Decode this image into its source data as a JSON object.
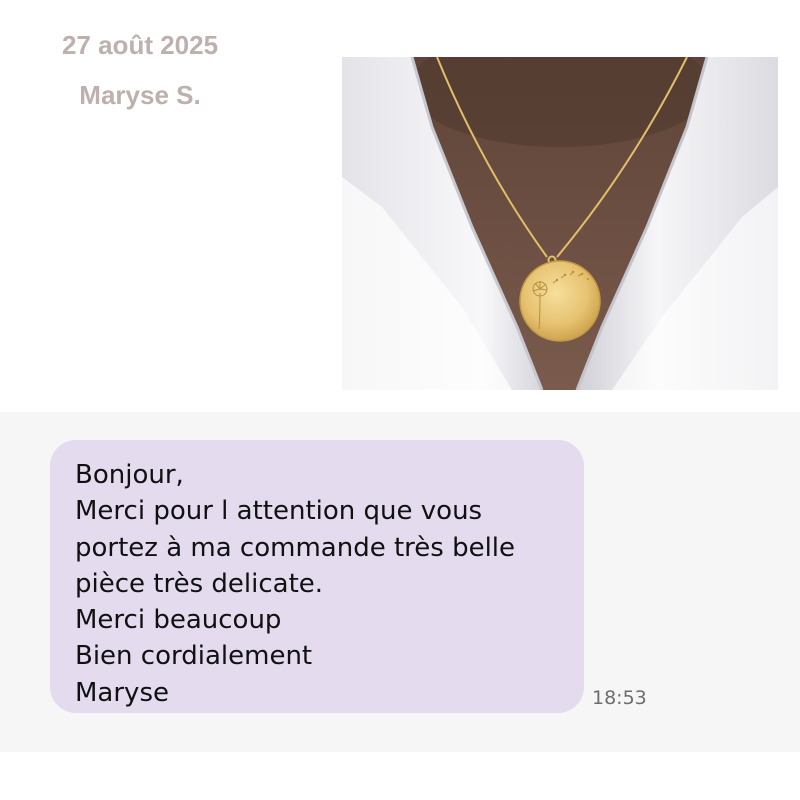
{
  "header": {
    "date": "27 août 2025",
    "author": "Maryse S."
  },
  "photo": {
    "subject": "gold-medallion-necklace-dandelion-engraving"
  },
  "message": {
    "lines": [
      "Bonjour,",
      "Merci pour l attention que vous",
      "portez à ma commande très belle",
      "pièce très delicate.",
      "Merci beaucoup",
      "Bien cordialement",
      "Maryse"
    ],
    "time": "18:53",
    "bubble_color": "#e4dbee"
  },
  "colors": {
    "header_text": "#bdb0ad",
    "chat_background": "#f6f6f6",
    "gold": "#e3be6a"
  }
}
